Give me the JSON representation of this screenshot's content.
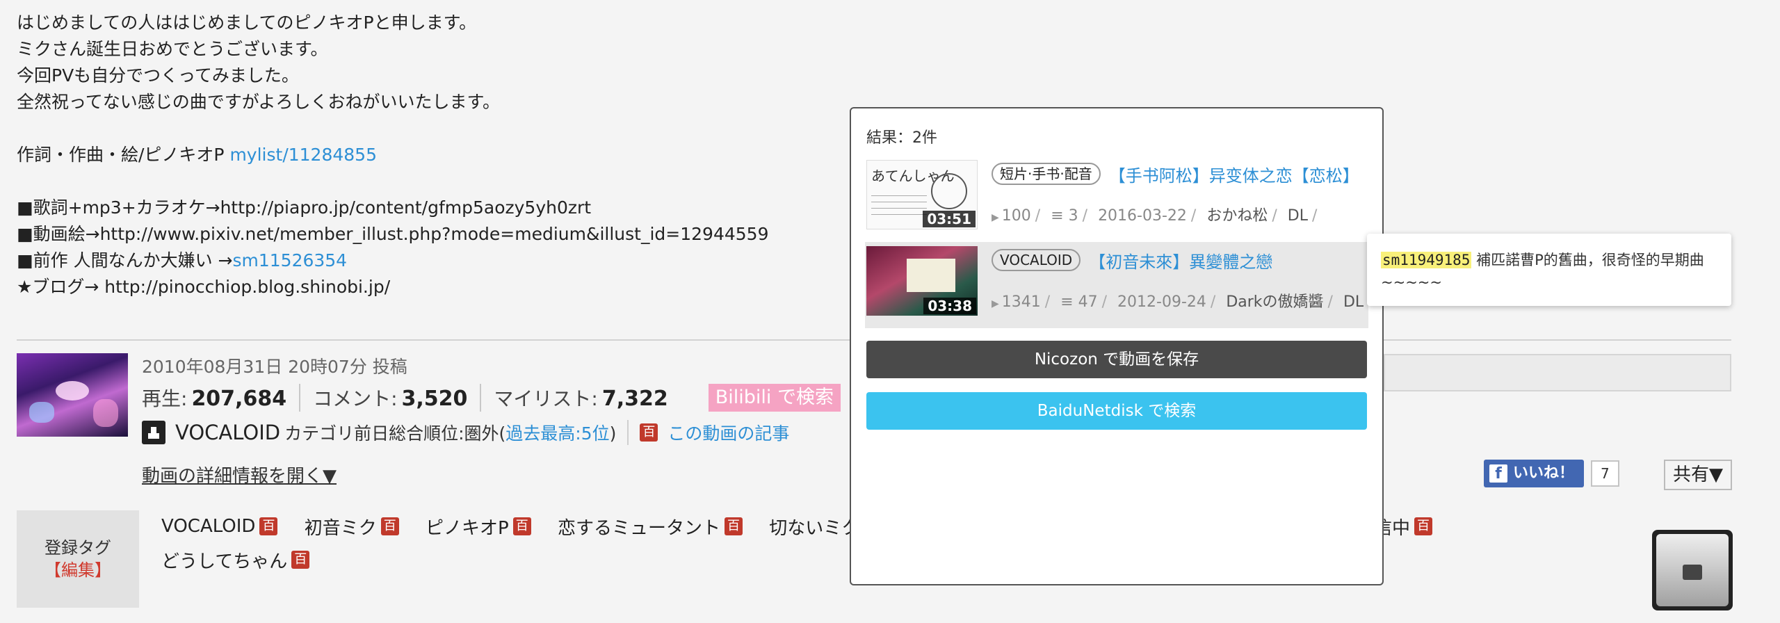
{
  "description": {
    "lines": [
      "はじめましての人ははじめましてのピノキオPと申します。",
      "ミクさん誕生日おめでとうございます。",
      "今回PVも自分でつくってみました。",
      "全然祝ってない感じの曲ですがよろしくおねがいいたします。"
    ],
    "credits_prefix": "作詞・作曲・絵/ピノキオP ",
    "credits_link": "mylist/11284855",
    "lyrics_line": "■歌詞+mp3+カラオケ→http://piapro.jp/content/gfmp5aozy5yh0zrt",
    "illust_line": "■動画絵→http://www.pixiv.net/member_illust.php?mode=medium&illust_id=12944559",
    "prev_prefix": "■前作 人間なんか大嫌い →",
    "prev_link": "sm11526354",
    "blog_line": "★ブログ→ http://pinocchiop.blog.shinobi.jp/"
  },
  "video": {
    "posted": "2010年08月31日 20時07分 投稿",
    "views_label": "再生:",
    "views": "207,684",
    "comments_label": "コメント:",
    "comments": "3,520",
    "mylist_label": "マイリスト:",
    "mylist": "7,322",
    "bilibili_button": "Bilibili で検索",
    "category": "VOCALOID",
    "rank_prefix": "カテゴリ前日総合順位:圏外(",
    "rank_link": "過去最高:5位",
    "rank_suffix": ")",
    "article_link": "この動画の記事",
    "details_toggle": "動画の詳細情報を開く▼",
    "fb_like": "いいね！",
    "fb_count": "7",
    "share": "共有▼"
  },
  "tags": {
    "label": "登録タグ",
    "edit": "【編集】",
    "dic_icon": "百",
    "row1": [
      "VOCALOID",
      "初音ミク",
      "ピノキオP",
      "恋するミュータント",
      "切ないミク"
    ],
    "row1_tail": "記信中",
    "row2": [
      "どうしてちゃん"
    ]
  },
  "popup": {
    "result_count": "結果：2件",
    "results": [
      {
        "thumb_text": "あてんしゃん",
        "duration": "03:51",
        "category": "短片·手书·配音",
        "title": "【手书阿松】异变体之恋【恋松】",
        "plays": "100",
        "danmaku": "≡ 3",
        "date": "2016-03-22",
        "uploader": "おかね松",
        "dl": "DL"
      },
      {
        "duration": "03:38",
        "category": "VOCALOID",
        "title": "【初音未來】異變體之戀",
        "plays": "1341",
        "danmaku": "≡ 47",
        "date": "2012-09-24",
        "uploader": "Darkの傲嬌醬",
        "dl": "DL"
      }
    ],
    "save_button": "Nicozon で動画を保存",
    "baidu_button": "BaiduNetdisk で検索"
  },
  "tooltip": {
    "id": "sm11949185",
    "text": " 補匹諾曹P的舊曲，很奇怪的早期曲~~~~~"
  },
  "colors": {
    "link": "#2d8fd5",
    "bilibili": "#f5a3c3",
    "save_button": "#4a4a4a",
    "baidu_button": "#3bc3ef",
    "facebook": "#4267b2",
    "tooltip_highlight": "#f8f07a"
  }
}
